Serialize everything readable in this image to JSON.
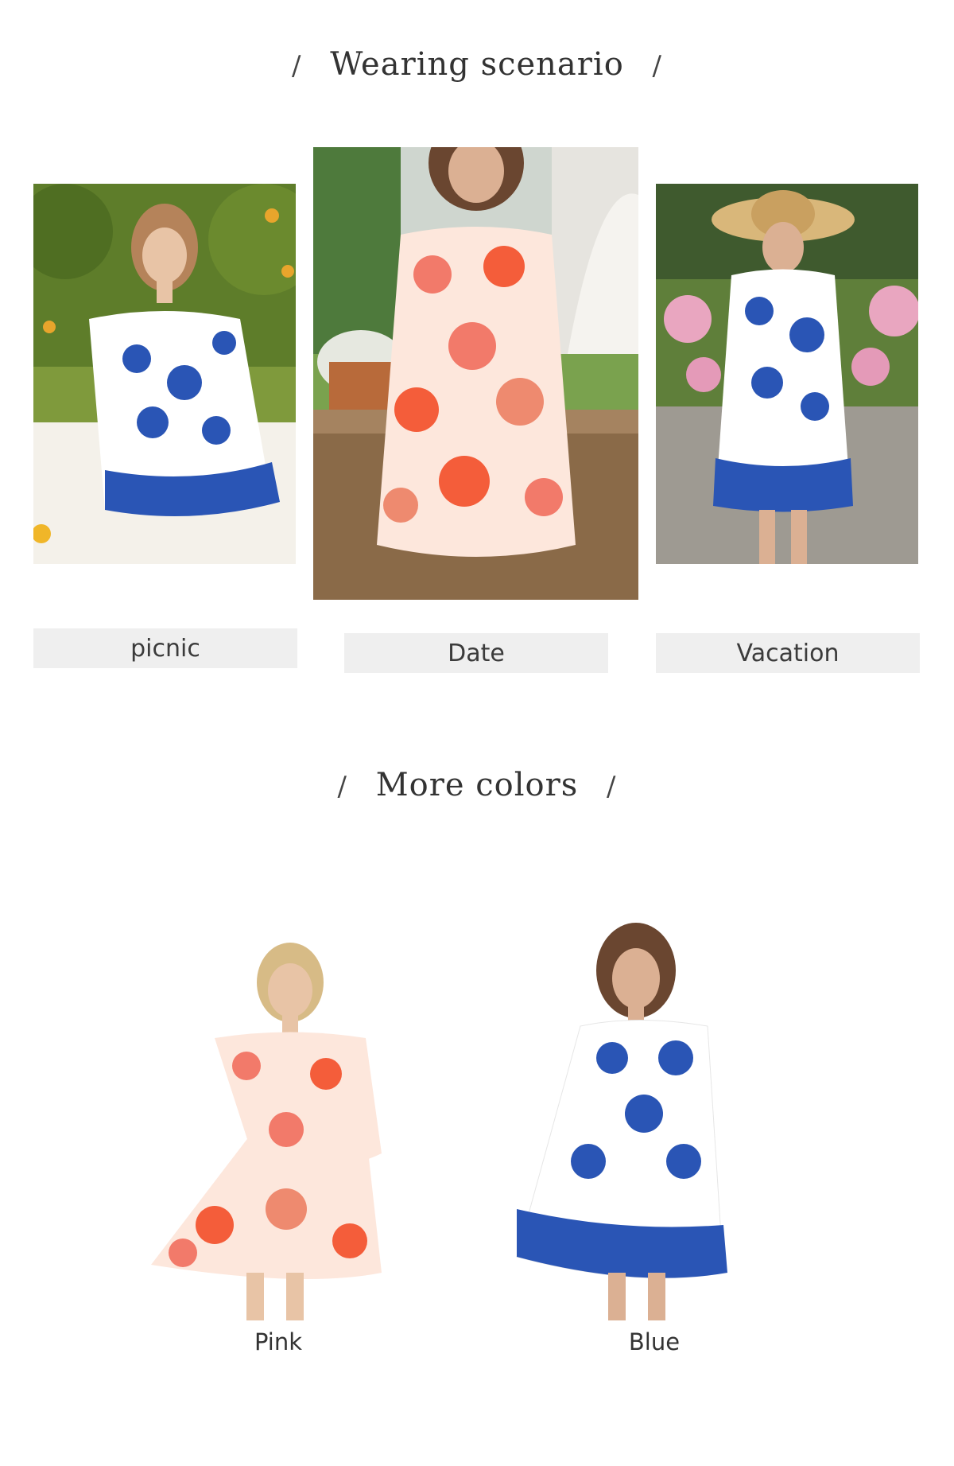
{
  "scenario_section": {
    "title": "Wearing scenario",
    "slash_left": "/",
    "slash_right": "/",
    "items": [
      {
        "label": "picnic"
      },
      {
        "label": "Date"
      },
      {
        "label": "Vacation"
      }
    ]
  },
  "colors_section": {
    "title": "More colors",
    "slash_left": "/",
    "slash_right": "/",
    "items": [
      {
        "label": "Pink"
      },
      {
        "label": "Blue"
      }
    ]
  },
  "palette": {
    "blue_print": "#2a55b5",
    "pink_print": "#f27a6a",
    "label_bg": "#efefef"
  }
}
